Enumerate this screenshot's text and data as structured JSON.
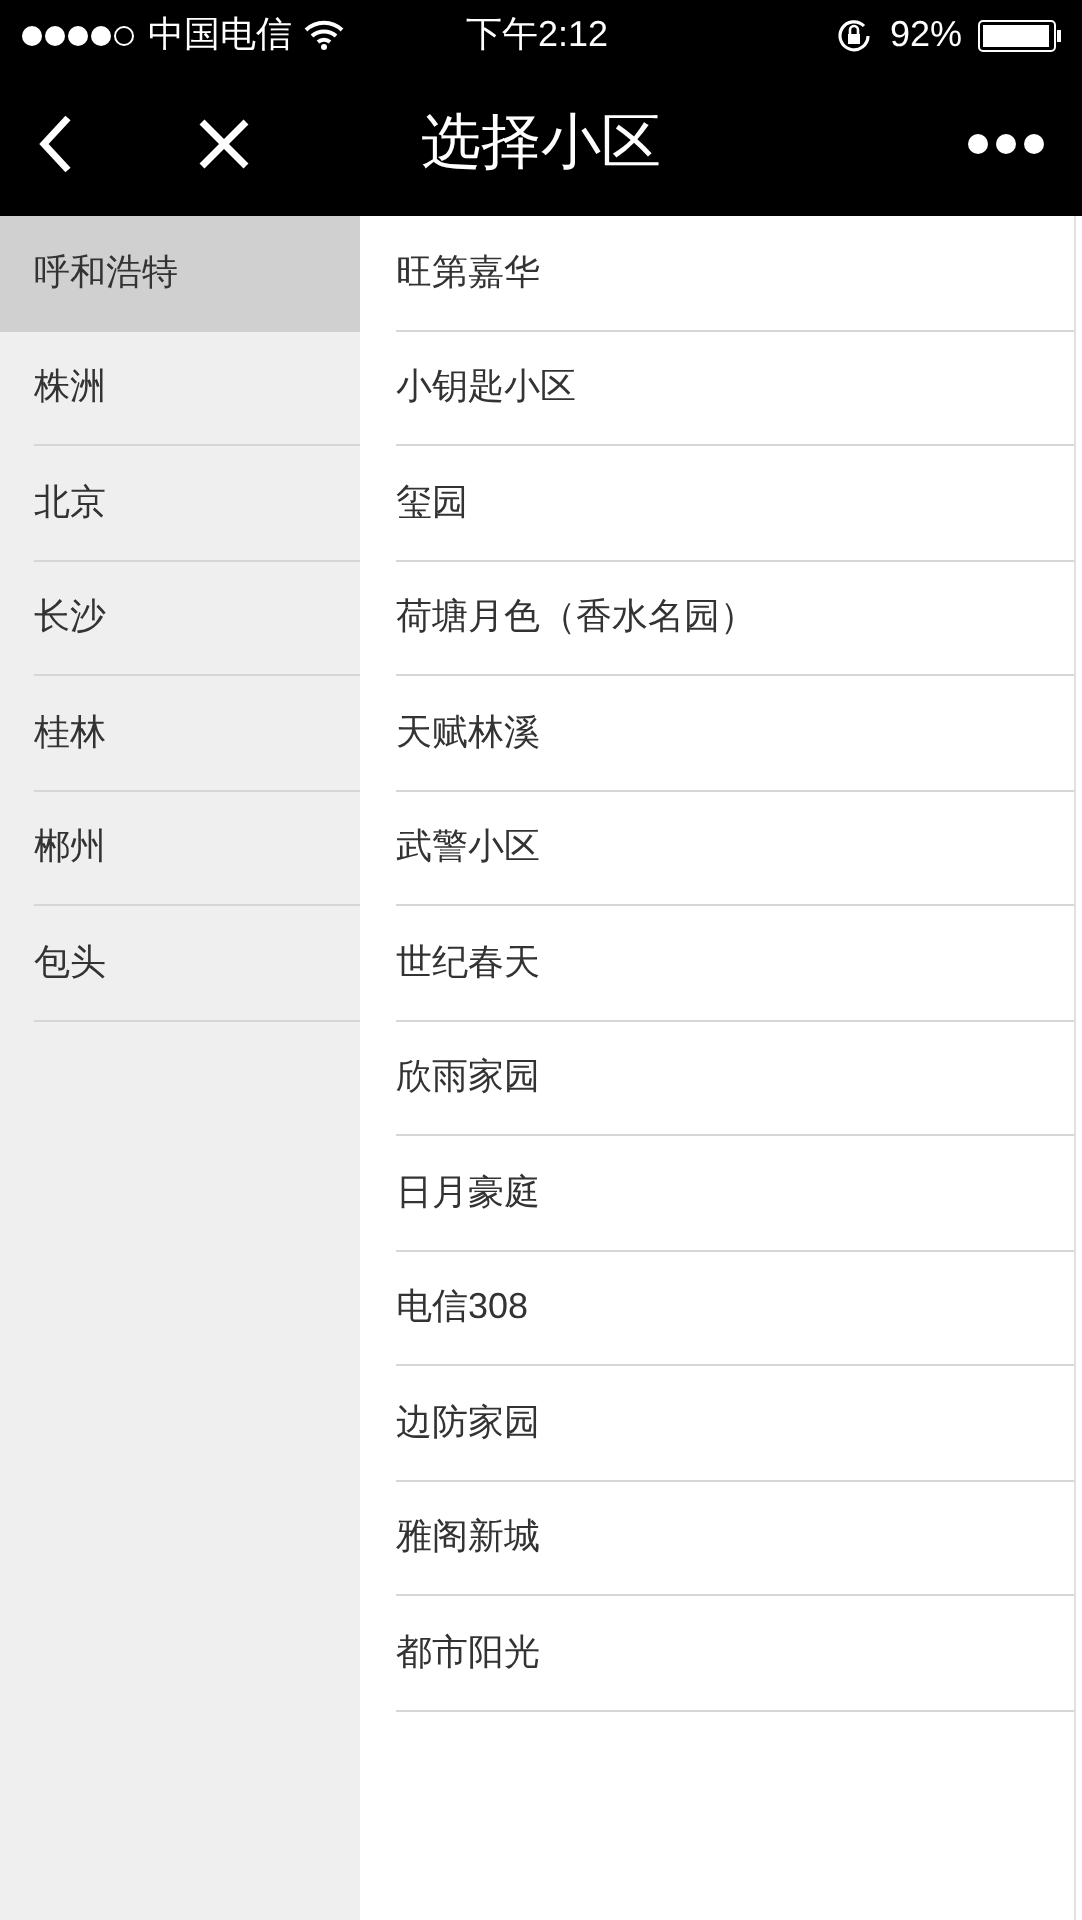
{
  "status_bar": {
    "carrier": "中国电信",
    "time": "下午2:12",
    "battery": "92%"
  },
  "nav": {
    "title": "选择小区"
  },
  "cities": [
    {
      "label": "呼和浩特",
      "selected": true
    },
    {
      "label": "株洲",
      "selected": false
    },
    {
      "label": "北京",
      "selected": false
    },
    {
      "label": "长沙",
      "selected": false
    },
    {
      "label": "桂林",
      "selected": false
    },
    {
      "label": "郴州",
      "selected": false
    },
    {
      "label": "包头",
      "selected": false
    }
  ],
  "communities": [
    "旺第嘉华",
    "小钥匙小区",
    "玺园",
    "荷塘月色（香水名园）",
    "天赋林溪",
    "武警小区",
    "世纪春天",
    "欣雨家园",
    "日月豪庭",
    "电信308",
    "边防家园",
    "雅阁新城",
    "都市阳光"
  ]
}
